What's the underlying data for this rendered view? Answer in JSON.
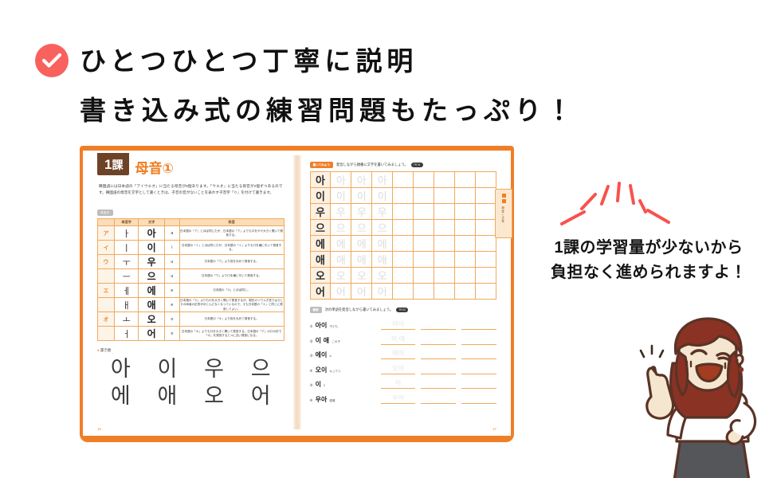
{
  "headline": {
    "check_icon": "check-circle-icon",
    "check_color": "#f9615e",
    "line1": "ひとつひとつ丁寧に説明",
    "line2": "書き込み式の練習問題もたっぷり！"
  },
  "caption": {
    "line1": "1課の学習量が少ないから",
    "line2": "負担なく進められますよ！",
    "sparkle_color": "#f8524f"
  },
  "book": {
    "left_page": {
      "lesson_number": "1課",
      "lesson_number_digit": "1",
      "lesson_number_unit": "課",
      "lesson_title": "母音①",
      "intro": "韓国語には日本語の「アイウエオ」に当たる母音が8個あります。「ウエオ」に当たる母音が2個ずつあるのです。韓国語の母音を文字として書くときは、子音の音がないことを表わす子音字「ㅇ」を付けて書きます。",
      "table_badge": "母音字",
      "table_headers": [
        "",
        "母音字",
        "文字",
        "",
        "発音"
      ],
      "rows": [
        {
          "kana": "ア",
          "jamo": "ㅏ",
          "char": "아",
          "rom": "a",
          "desc": "日本語の「ア」とほぼ同じだが、日本語の「ア」よりも口をやや大きく開いて発音する。"
        },
        {
          "kana": "イ",
          "jamo": "ㅣ",
          "char": "이",
          "rom": "i",
          "desc": "日本語の「イ」とほぼ同じだが、日本語の「イ」よりも口を横に引いて発音する。"
        },
        {
          "kana": "ウ",
          "jamo": "ㅜ",
          "char": "우",
          "rom": "u",
          "desc": "日本語の「ウ」より唇を丸めて発音する。"
        },
        {
          "kana": "",
          "jamo": "ㅡ",
          "char": "으",
          "rom": "u",
          "desc": "日本語の「ウ」より口を横に引いて発音する。"
        },
        {
          "kana": "エ",
          "jamo": "ㅔ",
          "char": "에",
          "rom": "e",
          "desc": "日本語の「エ」とほぼ同じ。"
        },
        {
          "kana": "",
          "jamo": "ㅐ",
          "char": "애",
          "rom": "e",
          "desc": "日本語の「エ」よりも口を大きく開いて発音するが、現在のソウル方言ではㅔとㅐの両者の区別がほとんどなくなっているので、ㅐも日本語の「エ」と同じに発音してよい。"
        },
        {
          "kana": "オ",
          "jamo": "ㅗ",
          "char": "오",
          "rom": "o",
          "desc": "日本語の「オ」より唇を丸めて発音する。"
        },
        {
          "kana": "",
          "jamo": "ㅓ",
          "char": "어",
          "rom": "o",
          "desc": "日本語の「オ」よりも口を大きく開いて発音する。日本語の「ア」の口の形で「オ」を発音すると≒に近い発音になる。"
        }
      ],
      "stroke_label": "書き順",
      "stroke_chars": [
        "아",
        "이",
        "우",
        "으",
        "에",
        "애",
        "오",
        "어"
      ],
      "page_number": "16"
    },
    "right_page": {
      "task1_chip": "書いてみよう",
      "task1_text": "発音しながら順番に文字を書いてみましょう。",
      "task1_track": "TR 01",
      "grid_columns": 9,
      "grid_rows": [
        {
          "model": "아",
          "traces": [
            "아",
            "아",
            "아"
          ],
          "blanks": 5
        },
        {
          "model": "이",
          "traces": [
            "이",
            "이",
            "이"
          ],
          "blanks": 5
        },
        {
          "model": "우",
          "traces": [
            "우",
            "우",
            "우"
          ],
          "blanks": 5
        },
        {
          "model": "으",
          "traces": [
            "으",
            "으",
            "으"
          ],
          "blanks": 5
        },
        {
          "model": "에",
          "traces": [
            "에",
            "에",
            "에"
          ],
          "blanks": 5
        },
        {
          "model": "애",
          "traces": [
            "애",
            "애",
            "애"
          ],
          "blanks": 5
        },
        {
          "model": "오",
          "traces": [
            "오",
            "오",
            "오"
          ],
          "blanks": 5
        },
        {
          "model": "어",
          "traces": [
            "어",
            "어",
            "어"
          ],
          "blanks": 5
        }
      ],
      "task2_chip": "練習",
      "task2_text": "次の単語を発音しながら書いてみましょう。",
      "task2_track": "TR 02",
      "exercises": [
        {
          "no": "①",
          "word": "아이",
          "gloss": "子ども",
          "ghost": "아이"
        },
        {
          "no": "②",
          "word": "이 애",
          "gloss": "この子",
          "ghost": "이 애"
        },
        {
          "no": "③",
          "word": "에이",
          "gloss": "A",
          "ghost": "에이"
        },
        {
          "no": "④",
          "word": "오이",
          "gloss": "キュウリ",
          "ghost": "오이"
        },
        {
          "no": "⑤",
          "word": "이",
          "gloss": "2",
          "ghost": "이"
        },
        {
          "no": "⑥",
          "word": "우아",
          "gloss": "優雅",
          "ghost": "우아"
        }
      ],
      "side_tab_text": "母音・子音",
      "page_number": "17"
    }
  },
  "character": {
    "name": "teacher-illustration",
    "hair_color": "#8a3224",
    "skin_color": "#f5e6cf",
    "blouse_color": "#ffffff",
    "skirt_color": "#55565a"
  }
}
